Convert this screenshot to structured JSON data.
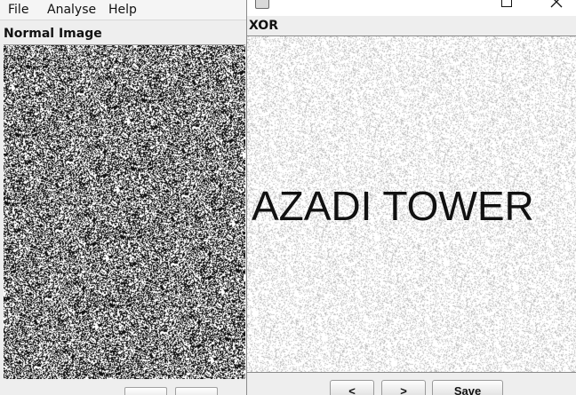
{
  "menubar": {
    "items": [
      "File",
      "Analyse",
      "Help"
    ]
  },
  "left_panel": {
    "title": "Normal Image"
  },
  "right_window": {
    "panel_title": "XOR",
    "decoded_text": "AZADI TOWER",
    "buttons": {
      "prev_label": "<",
      "next_label": ">",
      "save_label": "Save"
    }
  },
  "icons": {
    "app": "java-app-icon",
    "maximize": "maximize-icon",
    "close": "close-icon"
  },
  "colors": {
    "window_bg": "#eeeeee",
    "noise_dark": "#111111",
    "noise_light": "#ffffff",
    "text": "#111111"
  }
}
